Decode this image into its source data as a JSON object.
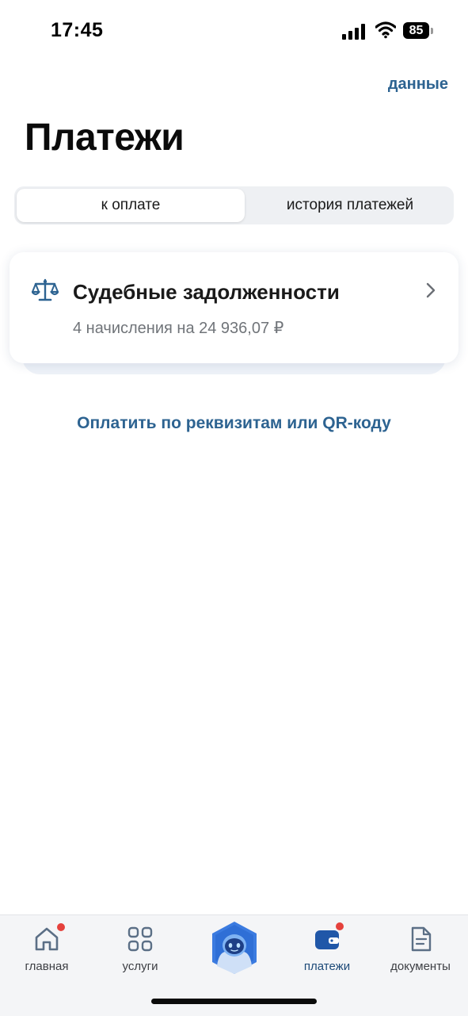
{
  "status_bar": {
    "time": "17:45",
    "battery_level": "85",
    "icons": [
      "signal-icon",
      "wifi-icon",
      "battery-icon"
    ]
  },
  "header": {
    "data_link": "данные",
    "title": "Платежи"
  },
  "tabs": [
    {
      "label": "к оплате",
      "active": true
    },
    {
      "label": "история платежей",
      "active": false
    }
  ],
  "debt_card": {
    "icon": "scales-icon",
    "title": "Судебные задолженности",
    "subtitle": "4 начисления на 24 936,07 ₽"
  },
  "pay_link": "Оплатить по реквизитам или QR-коду",
  "bottom_nav": {
    "items": [
      {
        "label": "главная",
        "icon": "home-icon",
        "badge": true
      },
      {
        "label": "услуги",
        "icon": "services-grid-icon",
        "badge": false
      },
      {
        "label": "",
        "icon": "assistant-avatar-icon",
        "badge": false
      },
      {
        "label": "платежи",
        "icon": "wallet-icon",
        "badge": true,
        "active": true
      },
      {
        "label": "документы",
        "icon": "document-icon",
        "badge": false
      }
    ]
  },
  "colors": {
    "accent": "#2d6391",
    "badge": "#e5413c",
    "assistant": "#2f6fd6"
  }
}
